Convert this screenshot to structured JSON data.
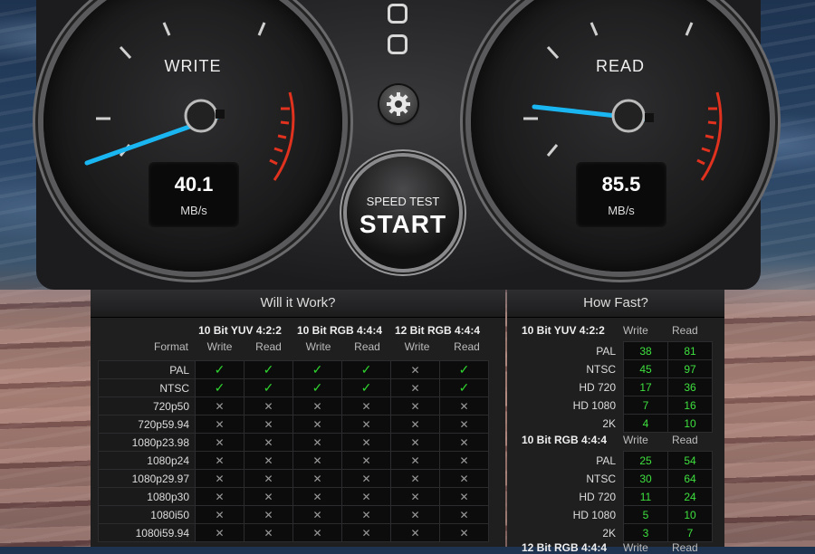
{
  "gauges": {
    "write": {
      "title": "WRITE",
      "value": "40.1",
      "unit": "MB/s"
    },
    "read": {
      "title": "READ",
      "value": "85.5",
      "unit": "MB/s"
    }
  },
  "start_button": {
    "small": "SPEED TEST",
    "big": "START"
  },
  "icons": {
    "window_buttons": "window-control-icons",
    "settings": "gear-icon"
  },
  "will_it_work": {
    "title": "Will it Work?",
    "format_label": "Format",
    "groups": [
      "10 Bit YUV 4:2:2",
      "10 Bit RGB 4:4:4",
      "12 Bit RGB 4:4:4"
    ],
    "sub_headers": [
      "Write",
      "Read",
      "Write",
      "Read",
      "Write",
      "Read"
    ],
    "rows": [
      {
        "format": "PAL",
        "cells": [
          "✓",
          "✓",
          "✓",
          "✓",
          "✕",
          "✓"
        ]
      },
      {
        "format": "NTSC",
        "cells": [
          "✓",
          "✓",
          "✓",
          "✓",
          "✕",
          "✓"
        ]
      },
      {
        "format": "720p50",
        "cells": [
          "✕",
          "✕",
          "✕",
          "✕",
          "✕",
          "✕"
        ]
      },
      {
        "format": "720p59.94",
        "cells": [
          "✕",
          "✕",
          "✕",
          "✕",
          "✕",
          "✕"
        ]
      },
      {
        "format": "1080p23.98",
        "cells": [
          "✕",
          "✕",
          "✕",
          "✕",
          "✕",
          "✕"
        ]
      },
      {
        "format": "1080p24",
        "cells": [
          "✕",
          "✕",
          "✕",
          "✕",
          "✕",
          "✕"
        ]
      },
      {
        "format": "1080p29.97",
        "cells": [
          "✕",
          "✕",
          "✕",
          "✕",
          "✕",
          "✕"
        ]
      },
      {
        "format": "1080p30",
        "cells": [
          "✕",
          "✕",
          "✕",
          "✕",
          "✕",
          "✕"
        ]
      },
      {
        "format": "1080i50",
        "cells": [
          "✕",
          "✕",
          "✕",
          "✕",
          "✕",
          "✕"
        ]
      },
      {
        "format": "1080i59.94",
        "cells": [
          "✕",
          "✕",
          "✕",
          "✕",
          "✕",
          "✕"
        ]
      }
    ]
  },
  "how_fast": {
    "title": "How Fast?",
    "sections": [
      {
        "name": "10 Bit YUV 4:2:2",
        "write_label": "Write",
        "read_label": "Read",
        "rows": [
          {
            "label": "PAL",
            "write": "38",
            "read": "81"
          },
          {
            "label": "NTSC",
            "write": "45",
            "read": "97"
          },
          {
            "label": "HD 720",
            "write": "17",
            "read": "36"
          },
          {
            "label": "HD 1080",
            "write": "7",
            "read": "16"
          },
          {
            "label": "2K",
            "write": "4",
            "read": "10"
          }
        ]
      },
      {
        "name": "10 Bit RGB 4:4:4",
        "write_label": "Write",
        "read_label": "Read",
        "rows": [
          {
            "label": "PAL",
            "write": "25",
            "read": "54"
          },
          {
            "label": "NTSC",
            "write": "30",
            "read": "64"
          },
          {
            "label": "HD 720",
            "write": "11",
            "read": "24"
          },
          {
            "label": "HD 1080",
            "write": "5",
            "read": "10"
          },
          {
            "label": "2K",
            "write": "3",
            "read": "7"
          }
        ]
      },
      {
        "name": "12 Bit RGB 4:4:4",
        "write_label": "Write",
        "read_label": "Read",
        "rows": []
      }
    ]
  },
  "colors": {
    "needle": "#1ab6f2",
    "ok": "#2fd42f",
    "value": "#3ee03e",
    "redzone": "#e0321e"
  }
}
